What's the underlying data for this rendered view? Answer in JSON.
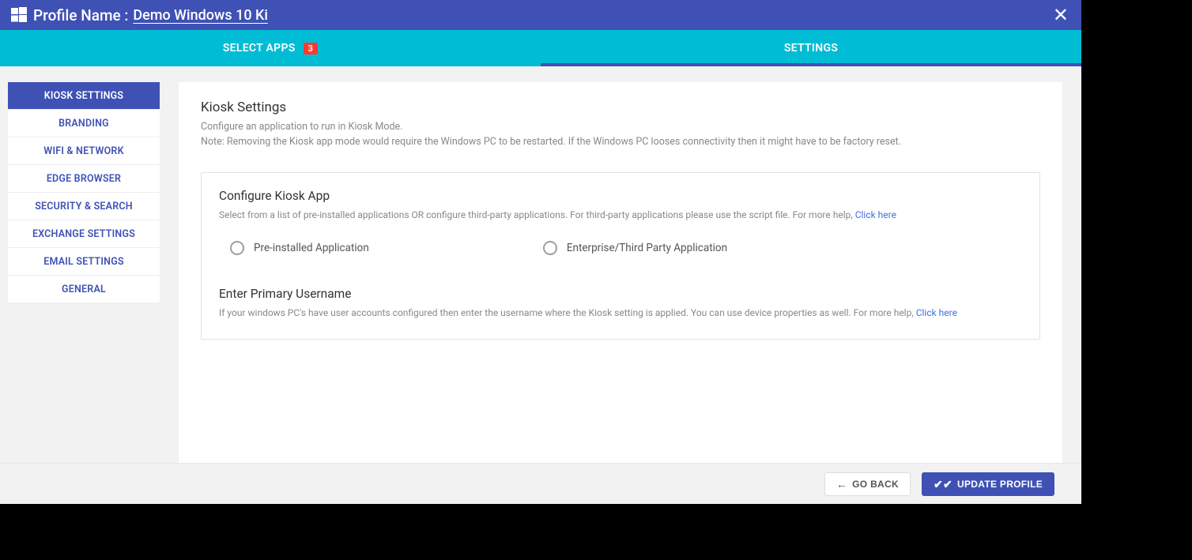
{
  "header": {
    "profile_label": "Profile Name :",
    "profile_value": "Demo Windows 10 Ki"
  },
  "tabs": {
    "select_apps": "SELECT APPS",
    "select_apps_badge": "3",
    "settings": "SETTINGS"
  },
  "sidebar": {
    "items": [
      "KIOSK SETTINGS",
      "BRANDING",
      "WIFI & NETWORK",
      "EDGE BROWSER",
      "SECURITY & SEARCH",
      "EXCHANGE SETTINGS",
      "EMAIL SETTINGS",
      "GENERAL"
    ]
  },
  "main": {
    "title": "Kiosk Settings",
    "desc": "Configure an application to run in Kiosk Mode.",
    "note": "Note: Removing the Kiosk app mode would require the Windows PC to be restarted. If the Windows PC looses connectivity then it might have to be factory reset.",
    "configure": {
      "title": "Configure Kiosk App",
      "desc_pre": "Select from a list of pre-installed applications OR configure third-party applications. For third-party applications please use the script file. For more help, ",
      "desc_link": "Click here",
      "opt_preinstalled": "Pre-installed Application",
      "opt_enterprise": "Enterprise/Third Party Application"
    },
    "username": {
      "title": "Enter Primary Username",
      "desc_pre": "If your windows PC's have user accounts configured then enter the username where the Kiosk setting is applied. You can use device properties as well. For more help, ",
      "desc_link": "Click here"
    }
  },
  "footer": {
    "back": "GO BACK",
    "update": "UPDATE PROFILE"
  }
}
